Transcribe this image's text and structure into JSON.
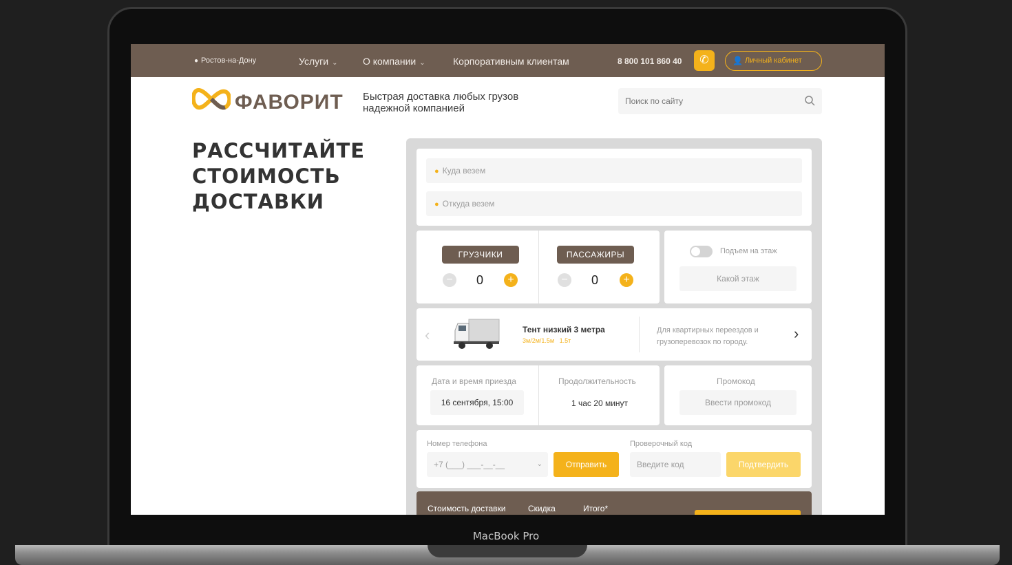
{
  "device": {
    "label": "MacBook Pro"
  },
  "topbar": {
    "city": "Ростов-на-Дону",
    "nav": [
      {
        "label": "Услуги",
        "has_dropdown": true
      },
      {
        "label": "О компании",
        "has_dropdown": true
      },
      {
        "label": "Корпоративным клиентам",
        "has_dropdown": false
      }
    ],
    "phone": "8 800 101 860 40",
    "cabinet_label": "Личный кабинет"
  },
  "header": {
    "brand": "ФАВОРИТ",
    "tagline": "Быстрая доставка любых грузов надежной компанией",
    "search_placeholder": "Поиск по сайту"
  },
  "hero": {
    "title_lines": [
      "РАССЧИТАЙТЕ",
      "СТОИМОСТЬ",
      "ДОСТАВКИ"
    ]
  },
  "calculator": {
    "to_placeholder": "Куда везем",
    "from_placeholder": "Откуда везем",
    "movers": {
      "label": "ГРУЗЧИКИ",
      "count": "0"
    },
    "passengers": {
      "label": "ПАССАЖИРЫ",
      "count": "0"
    },
    "floor_toggle_label": "Подъем на этаж",
    "floor_placeholder": "Какой этаж",
    "vehicle": {
      "name": "Тент низкий 3 метра",
      "specs": "3м/2м/1.5м   1.5т",
      "description": "Для квартирных переездов и грузоперевозок по городу."
    },
    "date": {
      "label": "Дата и время приезда",
      "value": "16 сентября, 15:00"
    },
    "duration": {
      "label": "Продолжительность",
      "value": "1 час 20 минут"
    },
    "promo": {
      "label": "Промокод",
      "placeholder": "Ввести промокод"
    },
    "phone": {
      "label": "Номер телефона",
      "placeholder": "+7 (___) ___-__-__",
      "send_label": "Отправить"
    },
    "code": {
      "label": "Проверочный код",
      "placeholder": "Введите код",
      "confirm_label": "Подтвердить"
    },
    "summary": {
      "cost_label": "Стоимость доставки",
      "discount_label": "Скидка",
      "total_label": "Итого*"
    }
  },
  "colors": {
    "brand_brown": "#6e5d51",
    "accent_yellow": "#f4b21b"
  }
}
